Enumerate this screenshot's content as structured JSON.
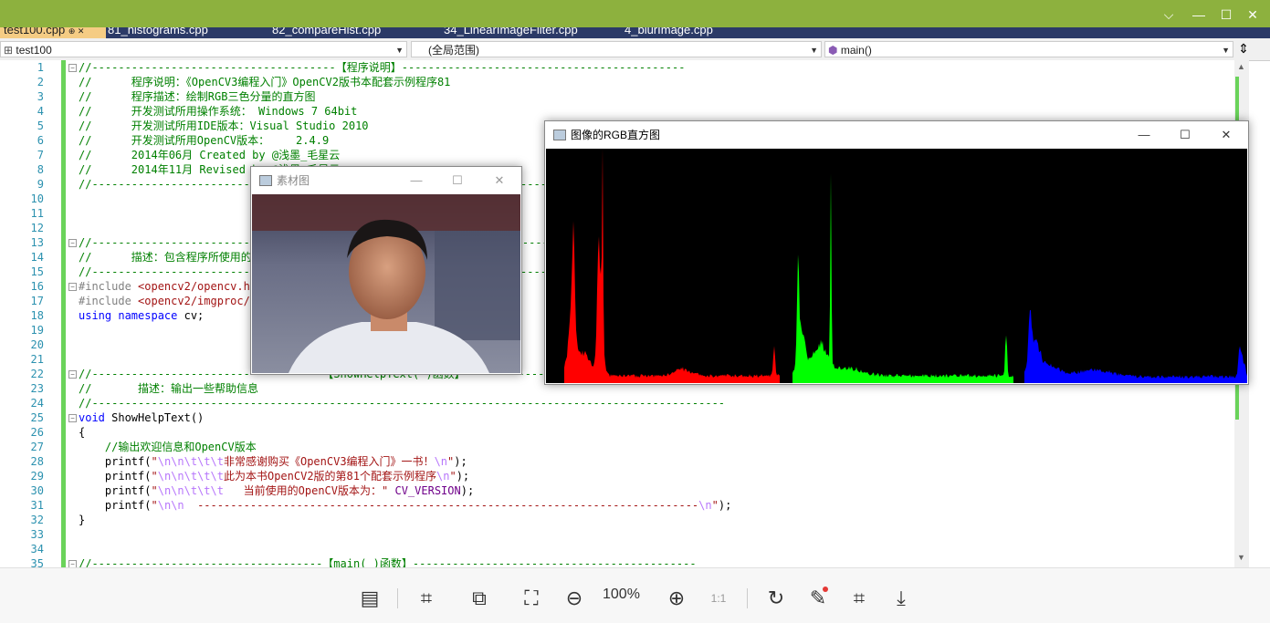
{
  "tabs": [
    "test100.cpp",
    "81_histograms.cpp",
    "82_compareHist.cpp",
    "34_LinearImageFilter.cpp",
    "4_blurImage.cpp"
  ],
  "nav": {
    "project": "test100",
    "scope": "(全局范围)",
    "member": "main()"
  },
  "code_lines": [
    {
      "n": "1",
      "t": "//-------------------------------------【程序说明】-------------------------------------------"
    },
    {
      "n": "2",
      "t": "//      程序说明：《OpenCV3编程入门》OpenCV2版书本配套示例程序81"
    },
    {
      "n": "3",
      "t": "//      程序描述：绘制RGB三色分量的直方图"
    },
    {
      "n": "4",
      "t": "//      开发测试所用操作系统： Windows 7 64bit"
    },
    {
      "n": "5",
      "t": "//      开发测试所用IDE版本：Visual Studio 2010"
    },
    {
      "n": "6",
      "t": "//      开发测试所用OpenCV版本：    2.4.9"
    },
    {
      "n": "7",
      "t": "//      2014年06月 Created by @浅墨_毛星云"
    },
    {
      "n": "8",
      "t": "//      2014年11月 Revised by @浅墨_毛星云"
    },
    {
      "n": "9",
      "t": "//------------------------------------------------------------------------------------------------"
    },
    {
      "n": "10",
      "t": ""
    },
    {
      "n": "11",
      "t": ""
    },
    {
      "n": "12",
      "t": ""
    },
    {
      "n": "13",
      "t": "//---------------------------------【头文件、命名空间包含部分】----------------------------"
    },
    {
      "n": "14",
      "t": "//      描述：包含程序所使用的头文件和命名空间"
    },
    {
      "n": "15",
      "t": "//------------------------------------------------------------------------------------------------"
    },
    {
      "n": "16",
      "t": "#include <opencv2/opencv.hpp>"
    },
    {
      "n": "17",
      "t": "#include <opencv2/imgproc/imgproc.hpp>"
    },
    {
      "n": "18",
      "t": "using namespace cv;"
    },
    {
      "n": "19",
      "t": ""
    },
    {
      "n": "20",
      "t": ""
    },
    {
      "n": "21",
      "t": ""
    },
    {
      "n": "22",
      "t": "//-----------------------------------【ShowHelpText( )函数】---------------------------------"
    },
    {
      "n": "23",
      "t": "//       描述：输出一些帮助信息"
    },
    {
      "n": "24",
      "t": "//------------------------------------------------------------------------------------------------"
    },
    {
      "n": "25",
      "t": "void ShowHelpText()"
    },
    {
      "n": "26",
      "t": "{"
    },
    {
      "n": "27",
      "t": "    //输出欢迎信息和OpenCV版本"
    },
    {
      "n": "28",
      "t": "    printf(\"\\n\\n\\t\\t\\t非常感谢购买《OpenCV3编程入门》一书！\\n\");"
    },
    {
      "n": "29",
      "t": "    printf(\"\\n\\n\\t\\t\\t此为本书OpenCV2版的第81个配套示例程序\\n\");"
    },
    {
      "n": "30",
      "t": "    printf(\"\\n\\n\\t\\t\\t   当前使用的OpenCV版本为：\" CV_VERSION);"
    },
    {
      "n": "31",
      "t": "    printf(\"\\n\\n  ----------------------------------------------------------------------------\\n\");"
    },
    {
      "n": "32",
      "t": "}"
    },
    {
      "n": "33",
      "t": ""
    },
    {
      "n": "34",
      "t": ""
    },
    {
      "n": "35",
      "t": "//-----------------------------------【main( )函数】-------------------------------------------"
    }
  ],
  "win_photo": {
    "title": "素材图"
  },
  "win_hist": {
    "title": "图像的RGB直方图"
  },
  "hist_colors": {
    "r": "#ff0000",
    "g": "#00ff00",
    "b": "#0000ff"
  },
  "toolbar": {
    "zoom": "100%"
  },
  "colors": {
    "titlebar": "#8db13e",
    "tabbar": "#2b3a67",
    "active_tab": "#f5cc84"
  }
}
